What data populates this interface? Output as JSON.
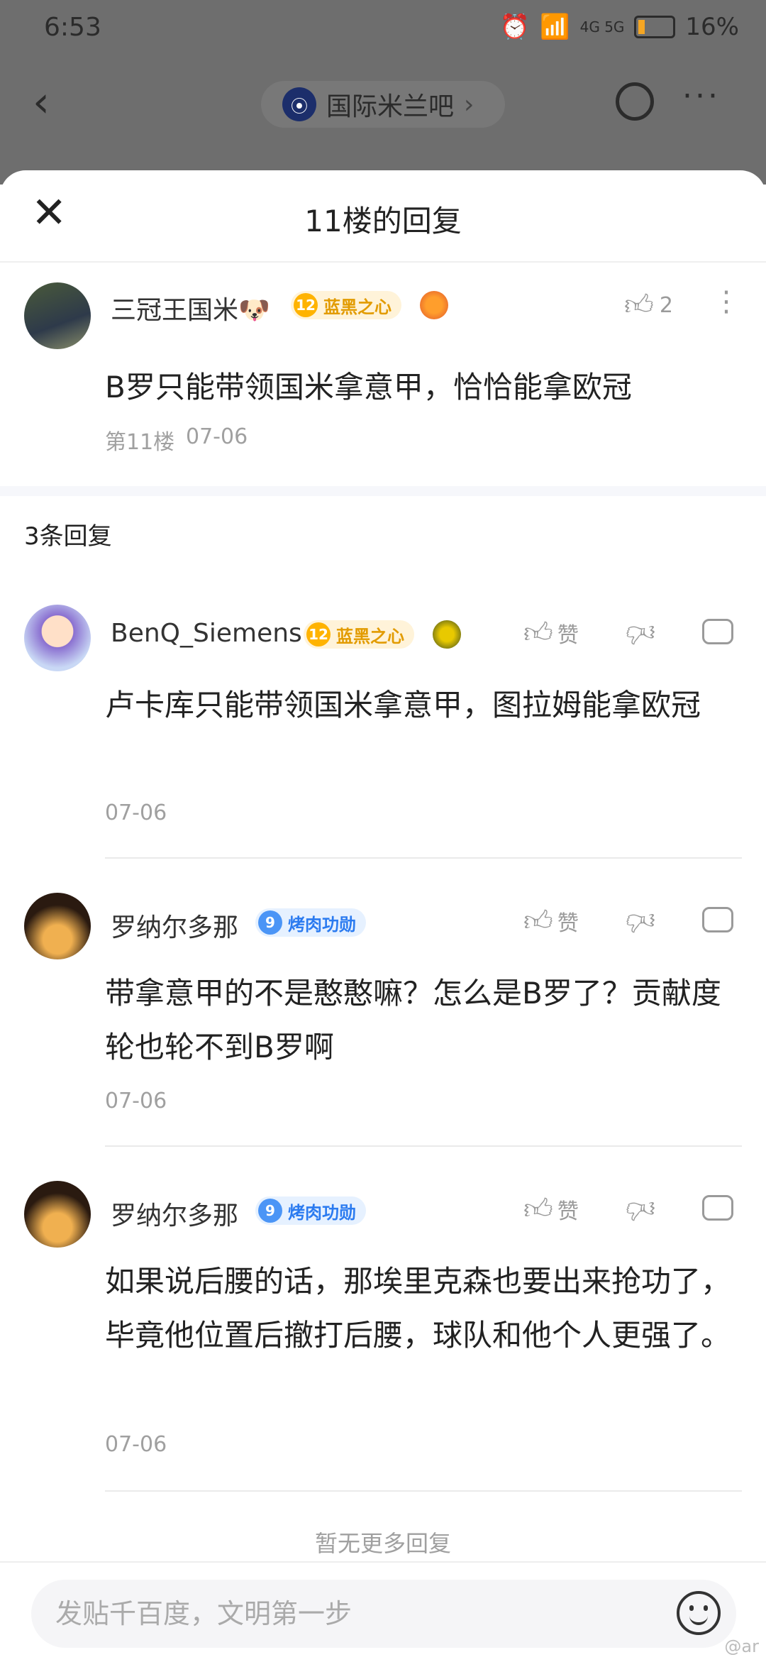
{
  "status": {
    "time": "6:53",
    "battery": "16%",
    "network": "4G 5G"
  },
  "topbar": {
    "forum_name": "国际米兰吧"
  },
  "sheet": {
    "title": "11楼的回复"
  },
  "main_post": {
    "username": "三冠王国米🐶",
    "level": "12",
    "level_title": "蓝黑之心",
    "likes": "2",
    "content": "B罗只能带领国米拿意甲，恰恰能拿欧冠",
    "floor": "第11楼",
    "date": "07-06"
  },
  "reply_count": "3条回复",
  "replies": [
    {
      "username": "BenQ_Siemens",
      "level": "12",
      "level_title": "蓝黑之心",
      "level_color": "gold",
      "like_label": "赞",
      "content": "卢卡库只能带领国米拿意甲，图拉姆能拿欧冠",
      "date": "07-06"
    },
    {
      "username": "罗纳尔多那",
      "level": "9",
      "level_title": "烤肉功勋",
      "level_color": "blue",
      "like_label": "赞",
      "content": "带拿意甲的不是憨憨嘛？怎么是B罗了？贡献度轮也轮不到B罗啊",
      "date": "07-06"
    },
    {
      "username": "罗纳尔多那",
      "level": "9",
      "level_title": "烤肉功勋",
      "level_color": "blue",
      "like_label": "赞",
      "content": "如果说后腰的话，那埃里克森也要出来抢功了，毕竟他位置后撤打后腰，球队和他个人更强了。",
      "date": "07-06"
    }
  ],
  "no_more": "暂无更多回复",
  "input_placeholder": "发贴千百度，文明第一步",
  "watermark": "@ar"
}
